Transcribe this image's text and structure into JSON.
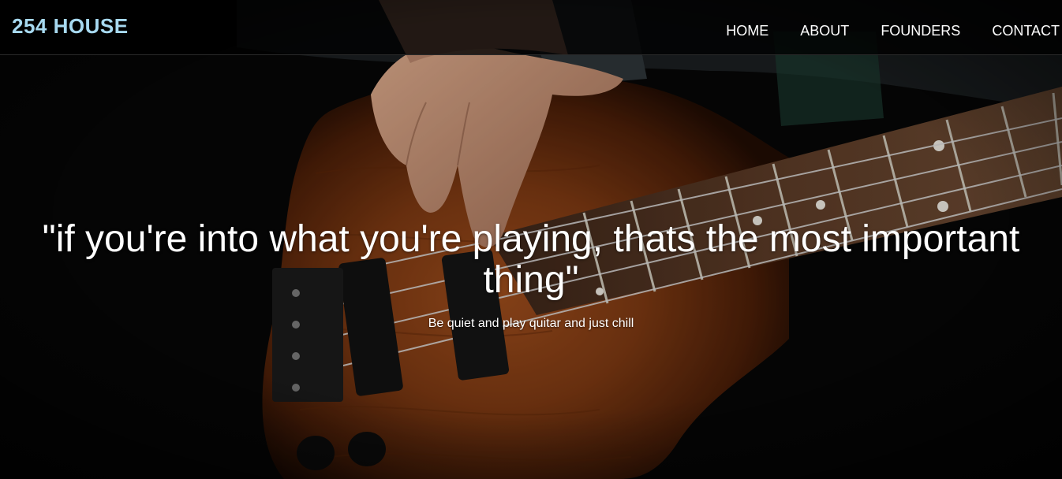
{
  "nav": {
    "brand": "254 HOUSE",
    "links": [
      {
        "label": "HOME"
      },
      {
        "label": "ABOUT"
      },
      {
        "label": "FOUNDERS"
      },
      {
        "label": "CONTACT"
      }
    ]
  },
  "hero": {
    "background_image": "bass-guitar-photo",
    "quote": "\"if you're into what you're playing, thats the most important thing\"",
    "subtitle": "Be quiet and play quitar and just chill"
  },
  "colors": {
    "brand": "#a7d9f0",
    "nav_text": "#ffffff",
    "nav_background": "#000000",
    "body_wood": "#7a3a14"
  }
}
